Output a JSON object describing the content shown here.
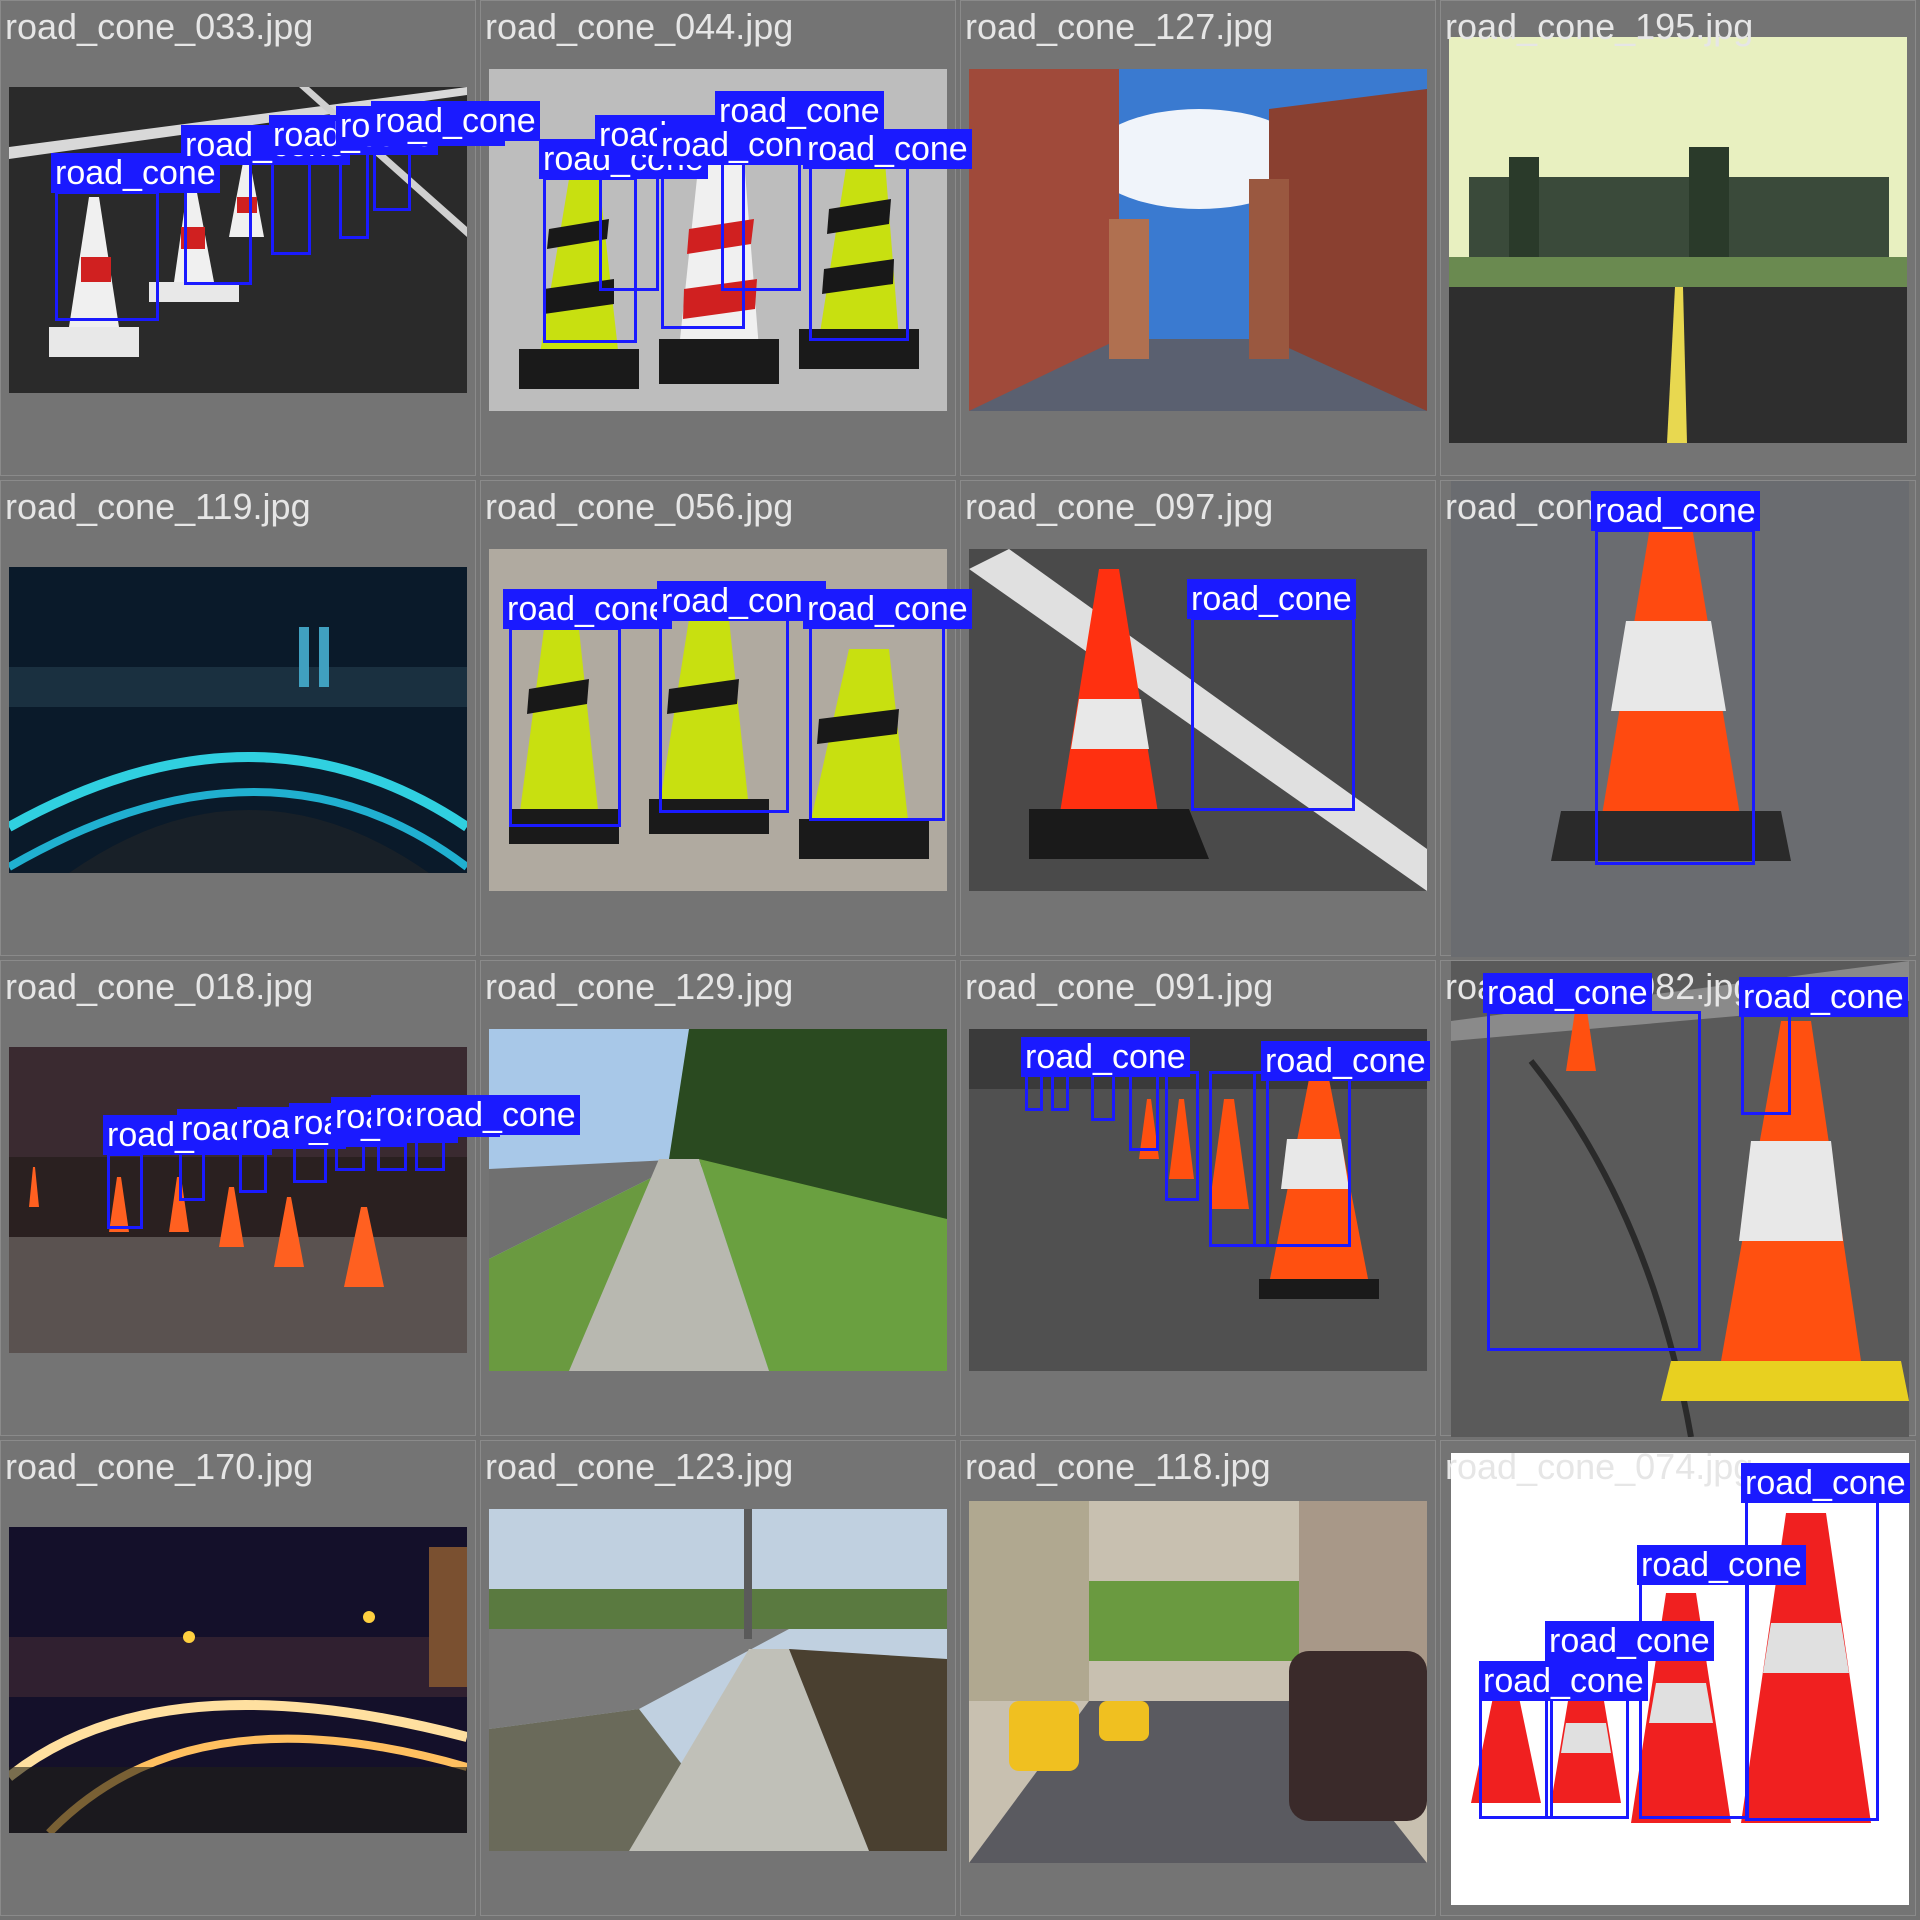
{
  "label_text": "road_cone",
  "colors": {
    "box": "#1a1aff",
    "tile_bg": "#747474",
    "filename_text": "#e6e6e6"
  },
  "tiles": [
    {
      "filename": "road_cone_033.jpg",
      "scene": "white-red cones on asphalt",
      "detections": 6
    },
    {
      "filename": "road_cone_044.jpg",
      "scene": "yellow-black and red-white cones",
      "detections": 6
    },
    {
      "filename": "road_cone_127.jpg",
      "scene": "city street with buildings",
      "detections": 0
    },
    {
      "filename": "road_cone_195.jpg",
      "scene": "road to skyline",
      "detections": 0
    },
    {
      "filename": "road_cone_119.jpg",
      "scene": "night highway and city",
      "detections": 0
    },
    {
      "filename": "road_cone_056.jpg",
      "scene": "three yellow-black cones with chain",
      "detections": 3
    },
    {
      "filename": "road_cone_097.jpg",
      "scene": "orange cone on asphalt",
      "detections": 1
    },
    {
      "filename": "road_cone_004.jpg",
      "scene": "single orange cone close-up",
      "detections": 1
    },
    {
      "filename": "road_cone_018.jpg",
      "scene": "night road with cones",
      "detections": 7
    },
    {
      "filename": "road_cone_129.jpg",
      "scene": "sidewalk and grass",
      "detections": 0
    },
    {
      "filename": "road_cone_091.jpg",
      "scene": "row of orange cones",
      "detections": 9
    },
    {
      "filename": "road_cone_082.jpg",
      "scene": "row of cones on road",
      "detections": 2
    },
    {
      "filename": "road_cone_170.jpg",
      "scene": "night highway with light trails",
      "detections": 0
    },
    {
      "filename": "road_cone_123.jpg",
      "scene": "sidewalk and road",
      "detections": 0
    },
    {
      "filename": "road_cone_118.jpg",
      "scene": "street with taxis",
      "detections": 0
    },
    {
      "filename": "road_cone_074.jpg",
      "scene": "four red cones on white",
      "detections": 4
    }
  ]
}
